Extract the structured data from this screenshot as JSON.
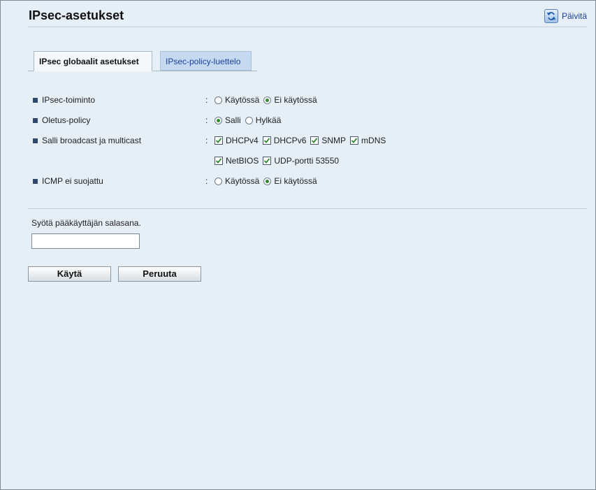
{
  "header": {
    "title": "IPsec-asetukset",
    "refresh_label": "Päivitä"
  },
  "tabs": [
    {
      "label": "IPsec globaalit asetukset",
      "active": true
    },
    {
      "label": "IPsec-policy-luettelo",
      "active": false
    }
  ],
  "settings": {
    "ipsec_function": {
      "label": "IPsec-toiminto",
      "options": [
        {
          "label": "Käytössä",
          "selected": false
        },
        {
          "label": "Ei käytössä",
          "selected": true
        }
      ]
    },
    "default_policy": {
      "label": "Oletus-policy",
      "options": [
        {
          "label": "Salli",
          "selected": true
        },
        {
          "label": "Hylkää",
          "selected": false
        }
      ]
    },
    "broadcast_multicast": {
      "label": "Salli broadcast ja multicast",
      "options": [
        {
          "label": "DHCPv4",
          "checked": true
        },
        {
          "label": "DHCPv6",
          "checked": true
        },
        {
          "label": "SNMP",
          "checked": true
        },
        {
          "label": "mDNS",
          "checked": true
        },
        {
          "label": "NetBIOS",
          "checked": true
        },
        {
          "label": "UDP-portti 53550",
          "checked": true
        }
      ]
    },
    "icmp_unprotected": {
      "label": "ICMP ei suojattu",
      "options": [
        {
          "label": "Käytössä",
          "selected": false
        },
        {
          "label": "Ei käytössä",
          "selected": true
        }
      ]
    }
  },
  "colon": ":",
  "password": {
    "label": "Syötä pääkäyttäjän salasana.",
    "value": ""
  },
  "buttons": {
    "apply": "Käytä",
    "cancel": "Peruuta"
  },
  "colors": {
    "background": "#e6eef6",
    "accent_link": "#1a3f9e",
    "radio_selected": "#2e8b2e",
    "checkmark": "#2e8b2e",
    "bullet": "#31486e",
    "inactive_tab": "#c5daf0"
  },
  "icons": {
    "refresh": "refresh-icon"
  }
}
